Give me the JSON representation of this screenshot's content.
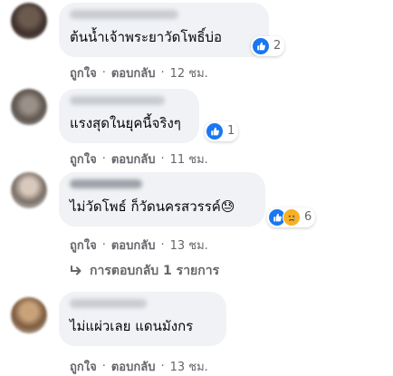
{
  "colors": {
    "bubble": "#f0f2f5",
    "meta": "#65676b",
    "like": "#1877f2",
    "sad": "#f7b125"
  },
  "actions": {
    "like_label": "ถูกใจ",
    "reply_label": "ตอบกลับ",
    "separator": "·"
  },
  "comments": [
    {
      "text": "ต้นน้ำเจ้าพระยาวัดโพธิ์บ่อ",
      "reactions": [
        "like-icon"
      ],
      "reaction_count": "2",
      "time": "12 ชม."
    },
    {
      "text": "แรงสุดในยุคนี้จริงๆ",
      "reactions": [
        "like-icon"
      ],
      "reaction_count": "1",
      "time": "11 ชม."
    },
    {
      "text": "ไม่วัดโพธ์ ก็วัดนครสวรรค์😓",
      "reactions": [
        "like-icon",
        "sad-icon"
      ],
      "reaction_count": "6",
      "time": "13 ชม."
    },
    {
      "text": "ไม่แผ่วเลย แดนมังกร",
      "reactions": [],
      "reaction_count": "",
      "time": "13 ชม."
    }
  ],
  "replies": {
    "label": "การตอบกลับ 1 รายการ",
    "icon": "reply-arrow-icon"
  }
}
